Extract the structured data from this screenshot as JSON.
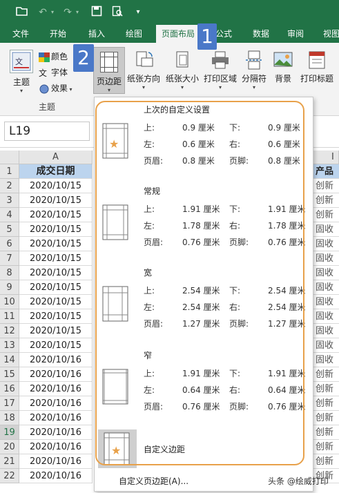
{
  "quick_access": {
    "icons": [
      "folder-open-icon",
      "undo-icon",
      "redo-icon",
      "save-icon",
      "print-preview-icon",
      "customize-icon"
    ]
  },
  "tabs": [
    {
      "label": "文件"
    },
    {
      "label": "开始"
    },
    {
      "label": "插入"
    },
    {
      "label": "绘图"
    },
    {
      "label": "页面布局"
    },
    {
      "label": "公式"
    },
    {
      "label": "数据"
    },
    {
      "label": "审阅"
    },
    {
      "label": "视图"
    }
  ],
  "ribbon": {
    "themes_label": "主题",
    "colors_label": "颜色",
    "fonts_label": "字体",
    "effects_label": "效果",
    "group_label": "主题",
    "margins_label": "页边距",
    "orientation_label": "纸张方向",
    "size_label": "纸张大小",
    "print_area_label": "打印区域",
    "breaks_label": "分隔符",
    "background_label": "背景",
    "print_titles_label": "打印标题"
  },
  "badges": {
    "one": "1",
    "two": "2"
  },
  "name_box": "L19",
  "sheet": {
    "col_a": "A",
    "col_right": "I",
    "header_a": "成交日期",
    "header_right": "产品",
    "rows": [
      {
        "n": "1",
        "a": "成交日期",
        "r": "产品"
      },
      {
        "n": "2",
        "a": "2020/10/15",
        "r": "创新"
      },
      {
        "n": "3",
        "a": "2020/10/15",
        "r": "创新"
      },
      {
        "n": "4",
        "a": "2020/10/15",
        "r": "创新"
      },
      {
        "n": "5",
        "a": "2020/10/15",
        "r": "固收"
      },
      {
        "n": "6",
        "a": "2020/10/15",
        "r": "固收"
      },
      {
        "n": "7",
        "a": "2020/10/15",
        "r": "固收"
      },
      {
        "n": "8",
        "a": "2020/10/15",
        "r": "固收"
      },
      {
        "n": "9",
        "a": "2020/10/15",
        "r": "固收"
      },
      {
        "n": "10",
        "a": "2020/10/15",
        "r": "固收"
      },
      {
        "n": "11",
        "a": "2020/10/15",
        "r": "固收"
      },
      {
        "n": "12",
        "a": "2020/10/15",
        "r": "固收"
      },
      {
        "n": "13",
        "a": "2020/10/15",
        "r": "固收"
      },
      {
        "n": "14",
        "a": "2020/10/16",
        "r": "固收"
      },
      {
        "n": "15",
        "a": "2020/10/16",
        "r": "创新"
      },
      {
        "n": "16",
        "a": "2020/10/16",
        "r": "创新"
      },
      {
        "n": "17",
        "a": "2020/10/16",
        "r": "创新"
      },
      {
        "n": "18",
        "a": "2020/10/16",
        "r": "创新"
      },
      {
        "n": "19",
        "a": "2020/10/16",
        "r": "创新"
      },
      {
        "n": "20",
        "a": "2020/10/16",
        "r": "创新"
      },
      {
        "n": "21",
        "a": "2020/10/16",
        "r": "创新"
      },
      {
        "n": "22",
        "a": "2020/10/16",
        "r": "创新"
      }
    ]
  },
  "margins_menu": {
    "options": [
      {
        "title": "上次的自定义设置",
        "top_label": "上:",
        "top": "0.9 厘米",
        "bottom_label": "下:",
        "bottom": "0.9 厘米",
        "left_label": "左:",
        "left": "0.6 厘米",
        "right_label": "右:",
        "right": "0.6 厘米",
        "header_label": "页眉:",
        "header": "0.8 厘米",
        "footer_label": "页脚:",
        "footer": "0.8 厘米"
      },
      {
        "title": "常规",
        "top_label": "上:",
        "top": "1.91 厘米",
        "bottom_label": "下:",
        "bottom": "1.91 厘米",
        "left_label": "左:",
        "left": "1.78 厘米",
        "right_label": "右:",
        "right": "1.78 厘米",
        "header_label": "页眉:",
        "header": "0.76 厘米",
        "footer_label": "页脚:",
        "footer": "0.76 厘米"
      },
      {
        "title": "宽",
        "top_label": "上:",
        "top": "2.54 厘米",
        "bottom_label": "下:",
        "bottom": "2.54 厘米",
        "left_label": "左:",
        "left": "2.54 厘米",
        "right_label": "右:",
        "right": "2.54 厘米",
        "header_label": "页眉:",
        "header": "1.27 厘米",
        "footer_label": "页脚:",
        "footer": "1.27 厘米"
      },
      {
        "title": "窄",
        "top_label": "上:",
        "top": "1.91 厘米",
        "bottom_label": "下:",
        "bottom": "1.91 厘米",
        "left_label": "左:",
        "left": "0.64 厘米",
        "right_label": "右:",
        "right": "0.64 厘米",
        "header_label": "页眉:",
        "header": "0.76 厘米",
        "footer_label": "页脚:",
        "footer": "0.76 厘米"
      }
    ],
    "custom_margins": "自定义边距",
    "custom_margins_link": "自定义页边距(A)..."
  },
  "watermark": "头条 @绘威打印",
  "colors": {
    "excel_green": "#217346",
    "badge_blue": "#4a78c8",
    "highlight_orange": "#e8a14a",
    "header_fill": "#bcd4ee"
  }
}
